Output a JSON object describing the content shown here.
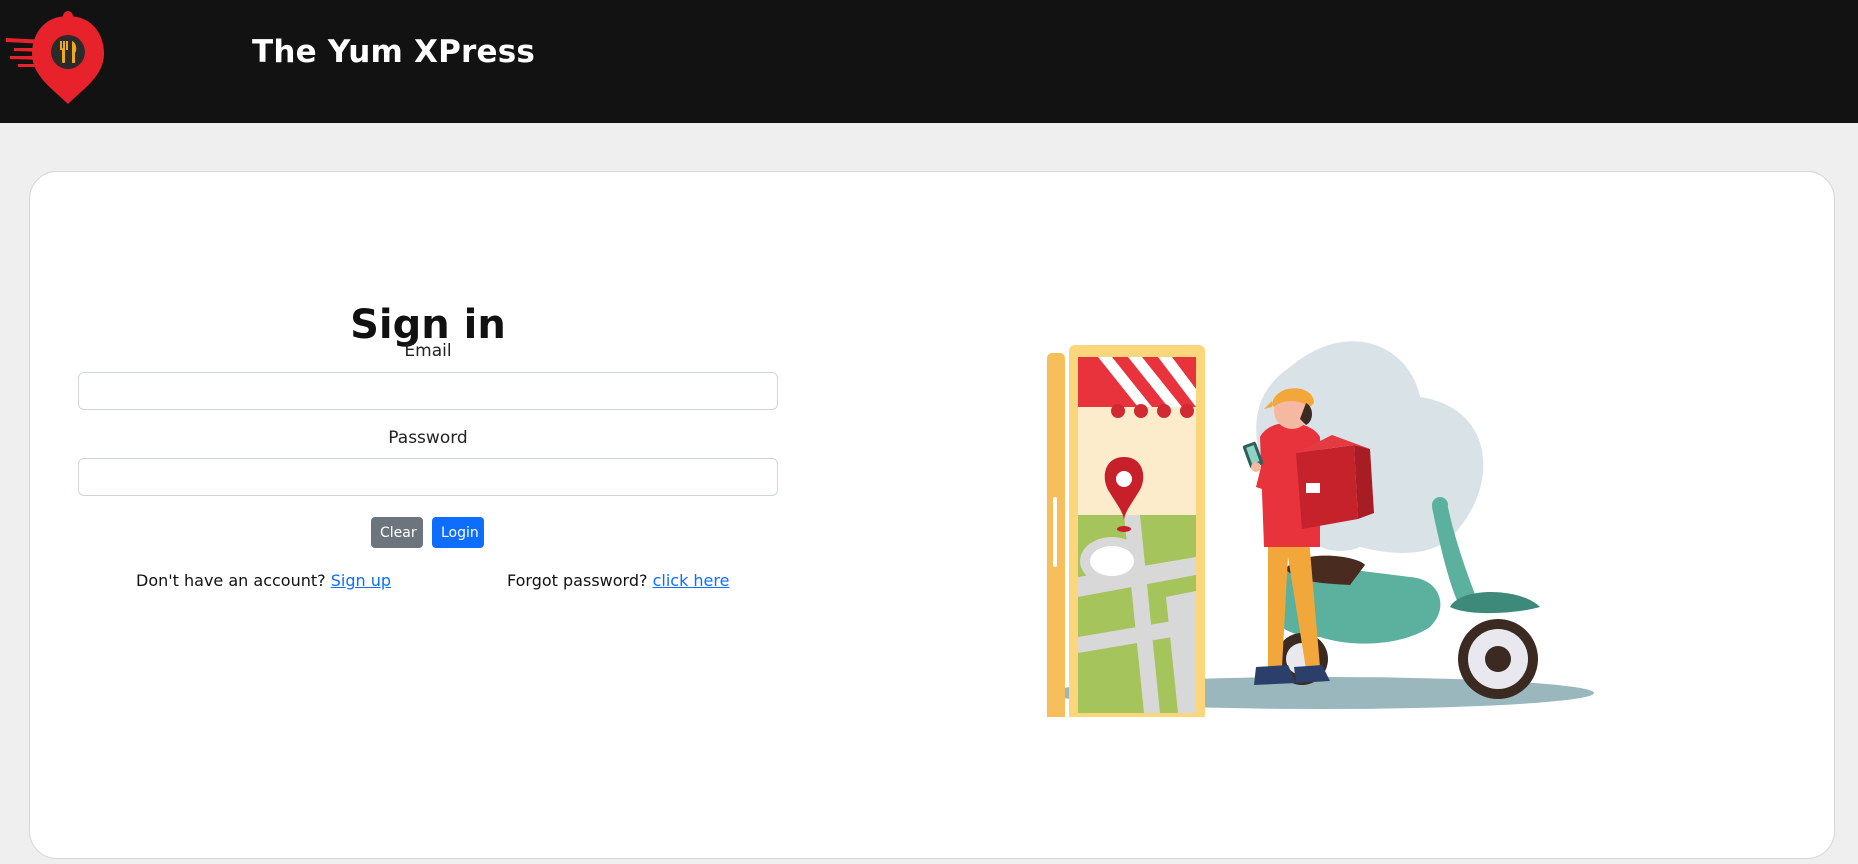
{
  "header": {
    "brand": "The Yum XPress",
    "logo_icon": "location-pin-fork-knife-icon",
    "brand_color": "#e8222b"
  },
  "signin": {
    "title": "Sign in",
    "email_label": "Email",
    "email_value": "",
    "password_label": "Password",
    "password_value": "",
    "clear_label": "Clear",
    "login_label": "Login",
    "signup_prompt": "Don't have an account?",
    "signup_link": "Sign up",
    "forgot_prompt": "Forgot password?",
    "forgot_link": "click here"
  },
  "colors": {
    "accent": "#0d6efd",
    "secondary": "#6c757d",
    "navbar": "#121212"
  },
  "illustration": {
    "icon": "delivery-rider-scooter-illustration"
  }
}
